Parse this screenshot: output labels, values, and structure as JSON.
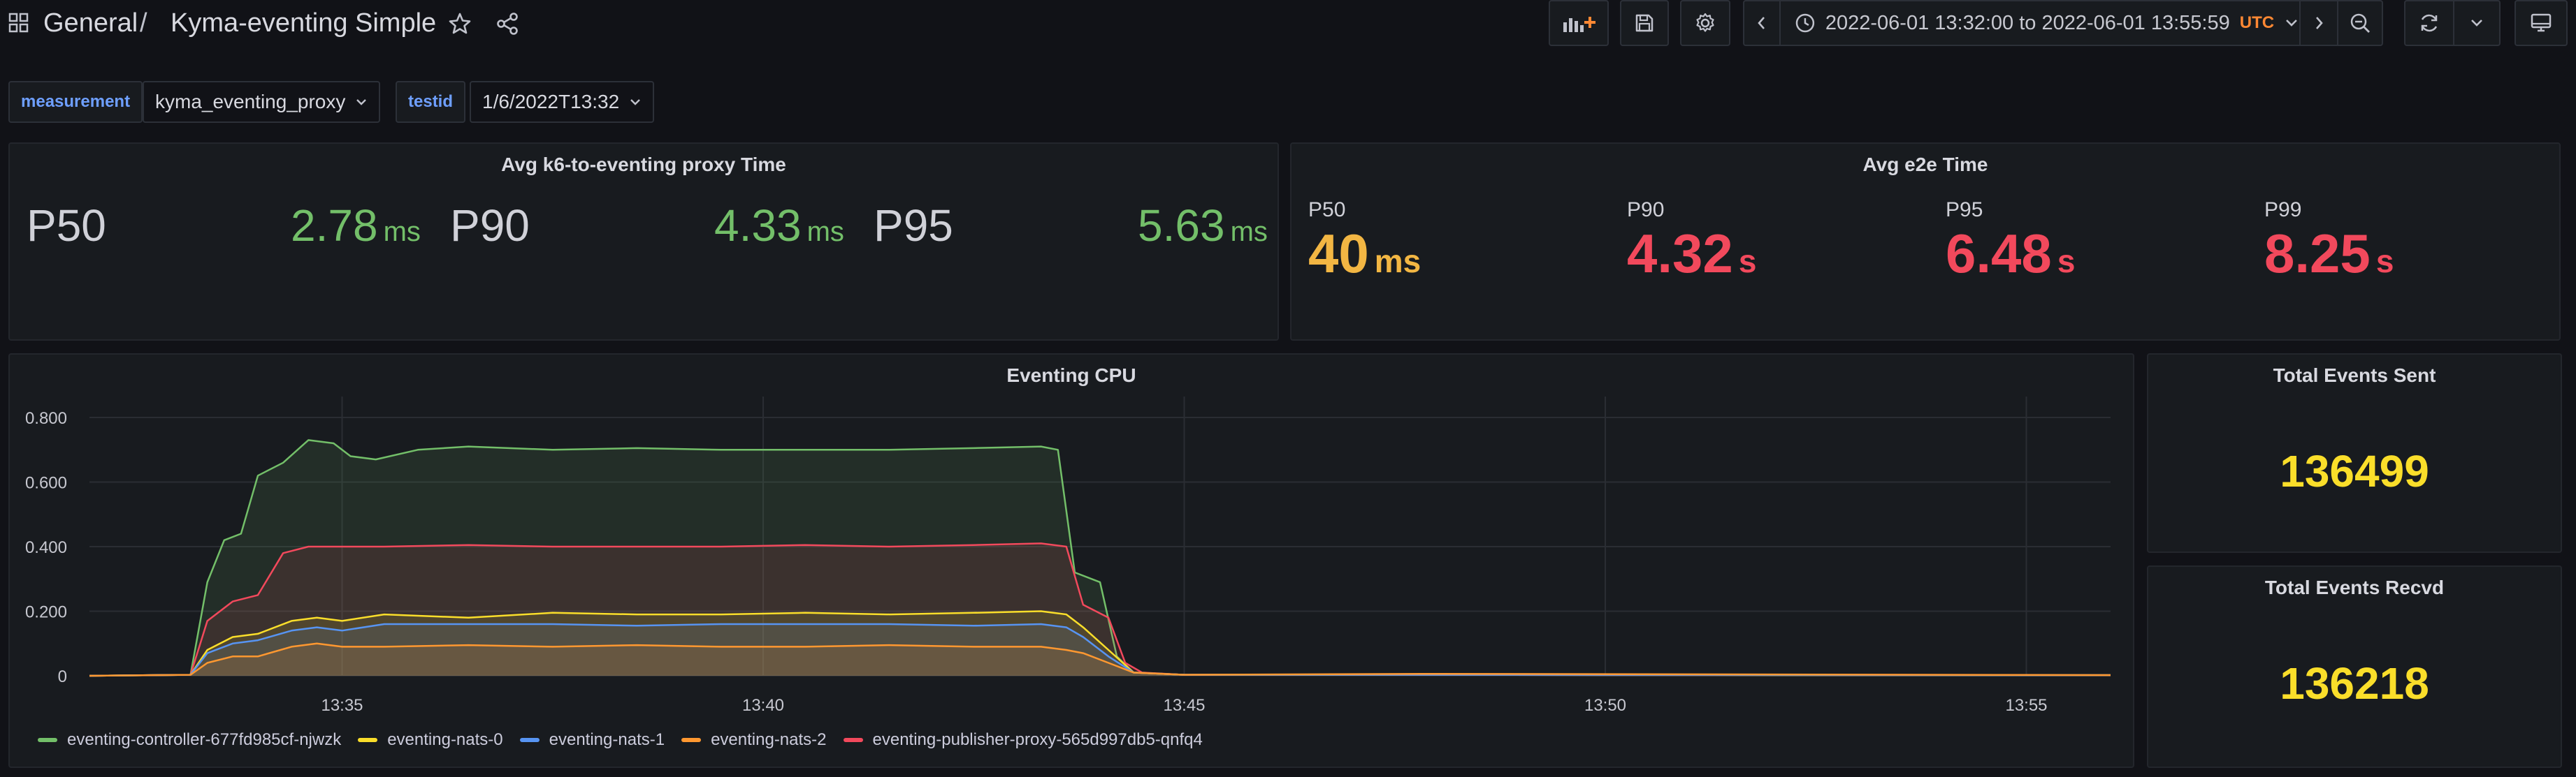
{
  "header": {
    "crumb_folder": "General",
    "crumb_sep": "/",
    "crumb_dashboard": "Kyma-eventing Simple",
    "icons": [
      "apps-icon",
      "star-icon",
      "share-icon",
      "add-panel-icon",
      "save-icon",
      "gear-icon",
      "chevron-left-icon",
      "clock-icon",
      "chevron-down-icon",
      "chevron-right-icon",
      "zoom-out-icon",
      "refresh-icon",
      "tv-icon"
    ]
  },
  "time_range": {
    "text": "2022-06-01 13:32:00 to 2022-06-01 13:55:59",
    "tz": "UTC"
  },
  "variables": [
    {
      "label": "measurement",
      "value": "kyma_eventing_proxy"
    },
    {
      "label": "testid",
      "value": "1/6/2022T13:32"
    }
  ],
  "colors": {
    "green": "#73bf69",
    "yellow": "#fade2a",
    "orange_yellow": "#f2b643",
    "red": "#f2495c"
  },
  "panel_proxy": {
    "title": "Avg k6-to-eventing proxy Time",
    "stats": [
      {
        "label": "P50",
        "value": "2.78",
        "unit": "ms"
      },
      {
        "label": "P90",
        "value": "4.33",
        "unit": "ms"
      },
      {
        "label": "P95",
        "value": "5.63",
        "unit": "ms"
      }
    ]
  },
  "panel_e2e": {
    "title": "Avg e2e Time",
    "stats": [
      {
        "label": "P50",
        "value": "40",
        "unit": "ms"
      },
      {
        "label": "P90",
        "value": "4.32",
        "unit": "s"
      },
      {
        "label": "P95",
        "value": "6.48",
        "unit": "s"
      },
      {
        "label": "P99",
        "value": "8.25",
        "unit": "s"
      }
    ]
  },
  "panel_sent": {
    "title": "Total Events Sent",
    "value": "136499"
  },
  "panel_recvd": {
    "title": "Total Events Recvd",
    "value": "136218"
  },
  "chart_data": {
    "type": "area",
    "title": "Eventing CPU",
    "xlabel": "",
    "ylabel": "",
    "x_ticks": [
      "13:35",
      "13:40",
      "13:45",
      "13:50",
      "13:55"
    ],
    "y_ticks": [
      "0",
      "0.200",
      "0.400",
      "0.600",
      "0.800"
    ],
    "ylim": [
      0,
      0.8
    ],
    "x_range_minutes": [
      32.0,
      56.0
    ],
    "grid": true,
    "legend_position": "bottom",
    "series": [
      {
        "name": "eventing-controller-677fd985cf-njwzk",
        "color": "#73bf69",
        "points": [
          [
            32.0,
            0
          ],
          [
            33.2,
            0.003
          ],
          [
            33.4,
            0.29
          ],
          [
            33.6,
            0.42
          ],
          [
            33.8,
            0.44
          ],
          [
            34.0,
            0.62
          ],
          [
            34.3,
            0.66
          ],
          [
            34.6,
            0.73
          ],
          [
            34.9,
            0.72
          ],
          [
            35.1,
            0.68
          ],
          [
            35.4,
            0.67
          ],
          [
            35.9,
            0.7
          ],
          [
            36.5,
            0.71
          ],
          [
            37.5,
            0.7
          ],
          [
            38.5,
            0.705
          ],
          [
            39.5,
            0.7
          ],
          [
            40.5,
            0.7
          ],
          [
            41.5,
            0.7
          ],
          [
            42.5,
            0.705
          ],
          [
            43.3,
            0.71
          ],
          [
            43.5,
            0.7
          ],
          [
            43.7,
            0.32
          ],
          [
            44.0,
            0.29
          ],
          [
            44.2,
            0.06
          ],
          [
            44.4,
            0.01
          ],
          [
            45,
            0.003
          ],
          [
            50,
            0.004
          ],
          [
            52,
            0.002
          ],
          [
            56.0,
            0.002
          ]
        ]
      },
      {
        "name": "eventing-nats-0",
        "color": "#fade2a",
        "points": [
          [
            32.0,
            0
          ],
          [
            33.2,
            0.003
          ],
          [
            33.4,
            0.08
          ],
          [
            33.7,
            0.12
          ],
          [
            34.0,
            0.13
          ],
          [
            34.4,
            0.17
          ],
          [
            34.7,
            0.18
          ],
          [
            35.0,
            0.17
          ],
          [
            35.5,
            0.19
          ],
          [
            36.5,
            0.18
          ],
          [
            37.5,
            0.195
          ],
          [
            38.5,
            0.19
          ],
          [
            39.5,
            0.19
          ],
          [
            40.5,
            0.195
          ],
          [
            41.5,
            0.19
          ],
          [
            42.5,
            0.195
          ],
          [
            43.3,
            0.2
          ],
          [
            43.6,
            0.19
          ],
          [
            43.8,
            0.15
          ],
          [
            44.1,
            0.08
          ],
          [
            44.4,
            0.01
          ],
          [
            45,
            0.003
          ],
          [
            56.0,
            0.002
          ]
        ]
      },
      {
        "name": "eventing-nats-1",
        "color": "#5794f2",
        "points": [
          [
            32.0,
            0
          ],
          [
            33.2,
            0.003
          ],
          [
            33.4,
            0.07
          ],
          [
            33.7,
            0.1
          ],
          [
            34.0,
            0.11
          ],
          [
            34.4,
            0.14
          ],
          [
            34.7,
            0.15
          ],
          [
            35.0,
            0.14
          ],
          [
            35.5,
            0.16
          ],
          [
            36.5,
            0.16
          ],
          [
            37.5,
            0.16
          ],
          [
            38.5,
            0.155
          ],
          [
            39.5,
            0.16
          ],
          [
            40.5,
            0.16
          ],
          [
            41.5,
            0.16
          ],
          [
            42.5,
            0.155
          ],
          [
            43.3,
            0.16
          ],
          [
            43.6,
            0.15
          ],
          [
            43.8,
            0.12
          ],
          [
            44.1,
            0.06
          ],
          [
            44.4,
            0.01
          ],
          [
            45,
            0.003
          ],
          [
            56.0,
            0.002
          ]
        ]
      },
      {
        "name": "eventing-nats-2",
        "color": "#ff9830",
        "points": [
          [
            32.0,
            0
          ],
          [
            33.2,
            0.003
          ],
          [
            33.4,
            0.04
          ],
          [
            33.7,
            0.06
          ],
          [
            34.0,
            0.06
          ],
          [
            34.4,
            0.09
          ],
          [
            34.7,
            0.1
          ],
          [
            35.0,
            0.09
          ],
          [
            35.5,
            0.09
          ],
          [
            36.5,
            0.095
          ],
          [
            37.5,
            0.09
          ],
          [
            38.5,
            0.095
          ],
          [
            39.5,
            0.09
          ],
          [
            40.5,
            0.09
          ],
          [
            41.5,
            0.095
          ],
          [
            42.5,
            0.09
          ],
          [
            43.3,
            0.09
          ],
          [
            43.6,
            0.08
          ],
          [
            43.8,
            0.07
          ],
          [
            44.1,
            0.04
          ],
          [
            44.4,
            0.01
          ],
          [
            45,
            0.003
          ],
          [
            48,
            0.006
          ],
          [
            56.0,
            0.002
          ]
        ]
      },
      {
        "name": "eventing-publisher-proxy-565d997db5-qnfq4",
        "color": "#f2495c",
        "points": [
          [
            32.0,
            0
          ],
          [
            33.2,
            0.003
          ],
          [
            33.4,
            0.17
          ],
          [
            33.7,
            0.23
          ],
          [
            34.0,
            0.25
          ],
          [
            34.3,
            0.38
          ],
          [
            34.6,
            0.4
          ],
          [
            35.0,
            0.4
          ],
          [
            35.5,
            0.4
          ],
          [
            36.5,
            0.405
          ],
          [
            37.5,
            0.4
          ],
          [
            38.5,
            0.4
          ],
          [
            39.5,
            0.4
          ],
          [
            40.5,
            0.405
          ],
          [
            41.5,
            0.4
          ],
          [
            42.5,
            0.405
          ],
          [
            43.3,
            0.41
          ],
          [
            43.6,
            0.4
          ],
          [
            43.8,
            0.22
          ],
          [
            44.1,
            0.18
          ],
          [
            44.3,
            0.04
          ],
          [
            44.5,
            0.01
          ],
          [
            45,
            0.003
          ],
          [
            56.0,
            0.002
          ]
        ]
      }
    ]
  }
}
